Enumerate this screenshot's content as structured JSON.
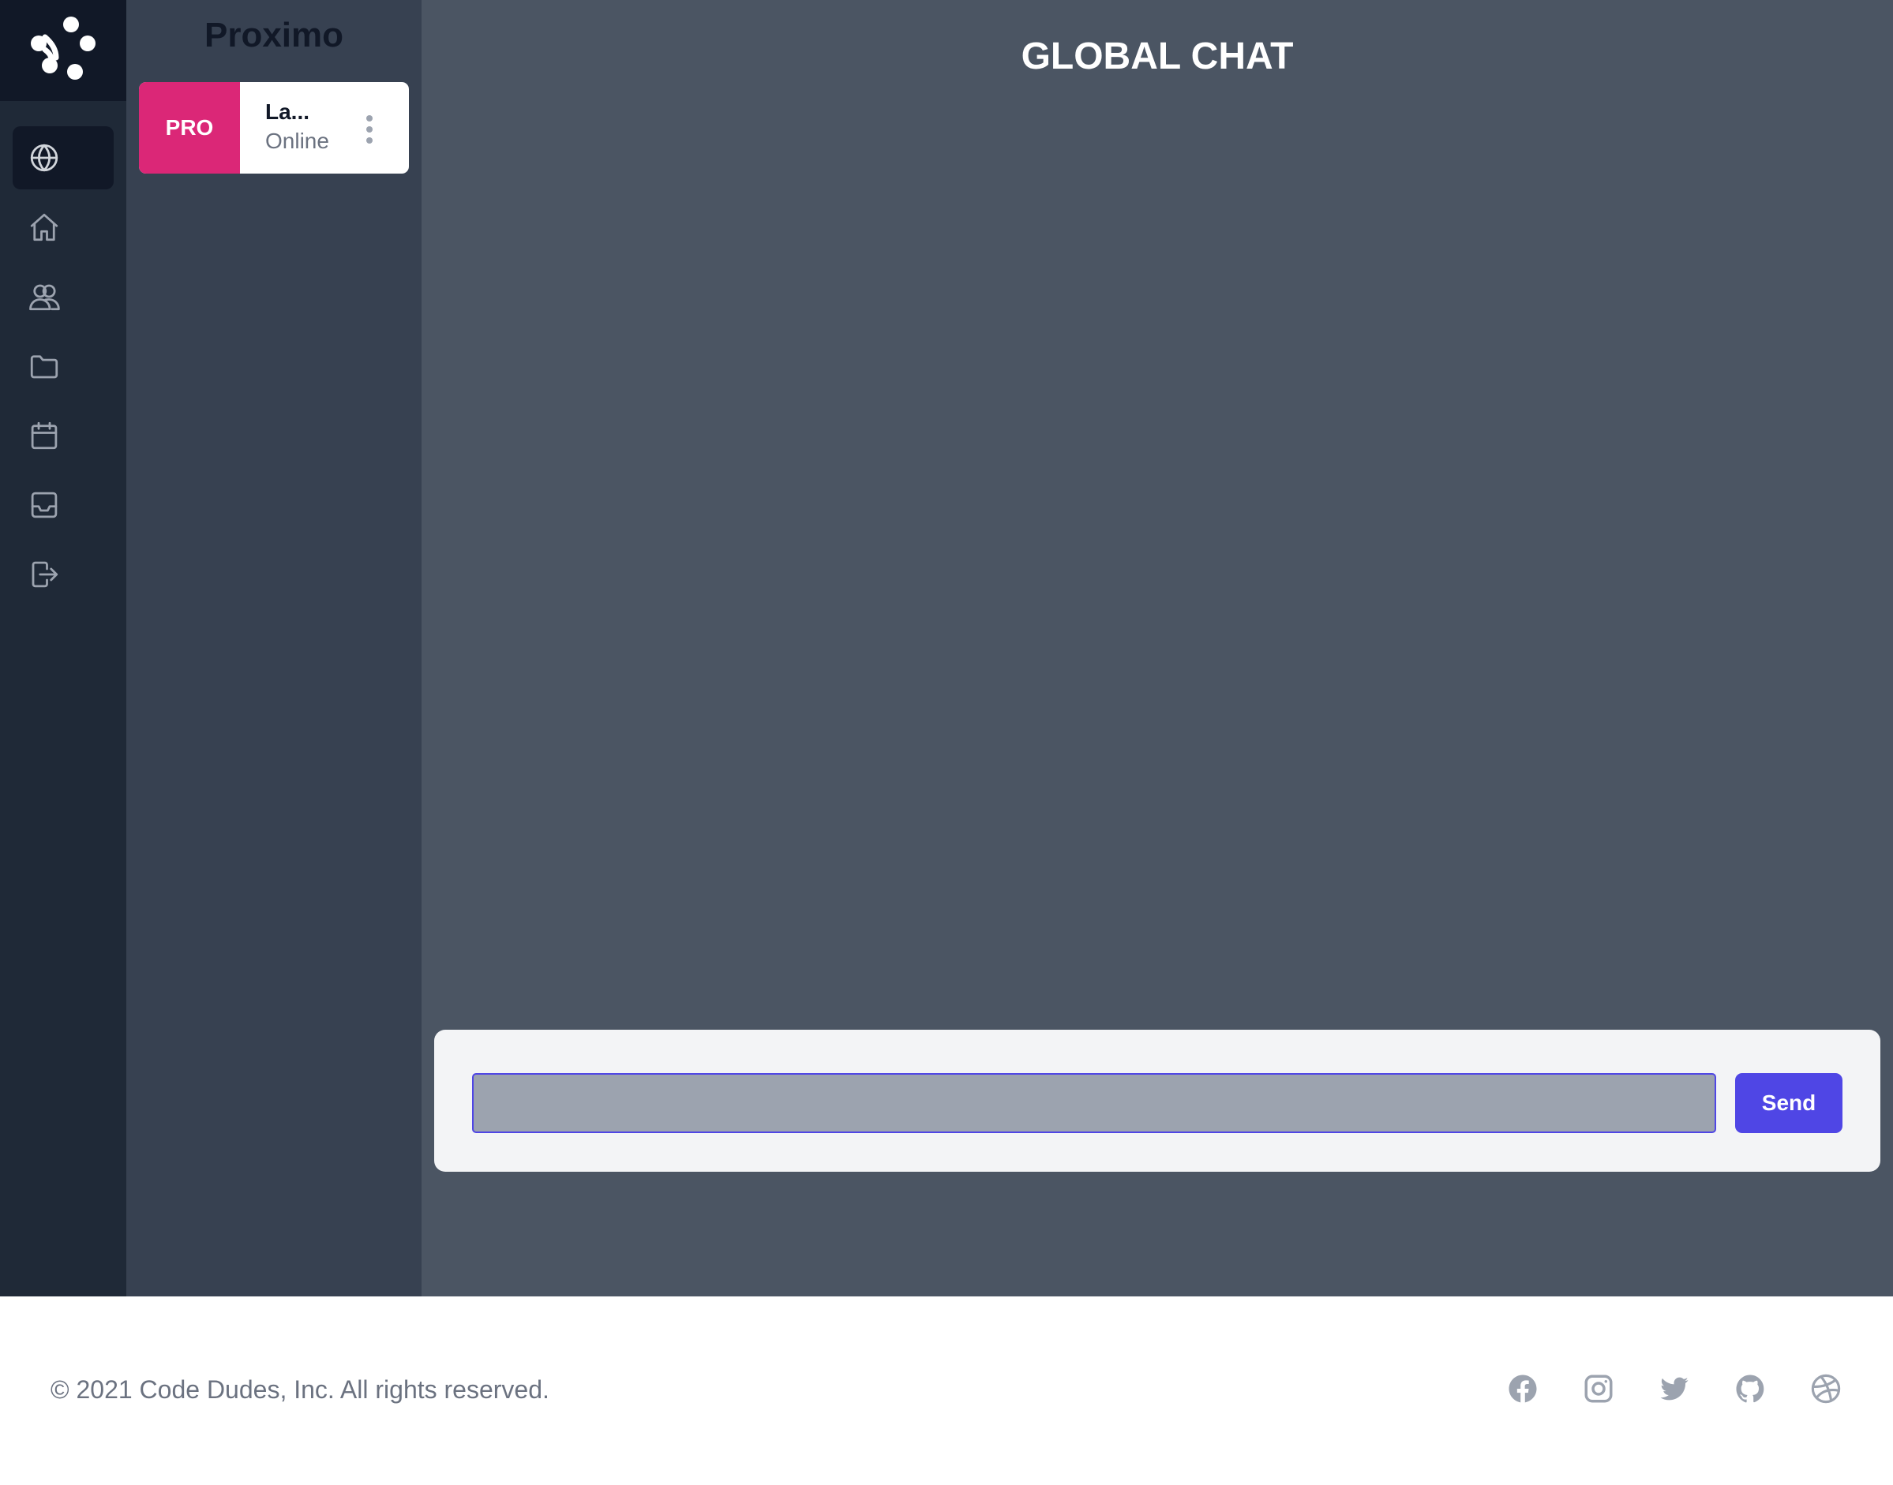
{
  "app": {
    "logo_icon": "molecule-logo-icon",
    "colors": {
      "rail": "#1f2937",
      "rail_active": "#111827",
      "panel": "#374151",
      "main": "#4b5563",
      "badge": "#db2777",
      "accent": "#4f46e5"
    }
  },
  "rail": {
    "items": [
      {
        "icon": "globe-icon",
        "active": true
      },
      {
        "icon": "home-icon"
      },
      {
        "icon": "users-icon"
      },
      {
        "icon": "folder-icon"
      },
      {
        "icon": "calendar-icon"
      },
      {
        "icon": "inbox-icon"
      },
      {
        "icon": "logout-icon"
      }
    ]
  },
  "panel": {
    "title": "Proximo",
    "user": {
      "badge": "PRO",
      "name": "La...",
      "status": "Online",
      "menu_icon": "more-vertical-icon"
    }
  },
  "chat": {
    "title": "GLOBAL CHAT",
    "input_value": "",
    "send_label": "Send"
  },
  "footer": {
    "copyright": "© 2021 Code Dudes, Inc. All rights reserved.",
    "socials": [
      "facebook-icon",
      "instagram-icon",
      "twitter-icon",
      "github-icon",
      "dribbble-icon"
    ]
  }
}
